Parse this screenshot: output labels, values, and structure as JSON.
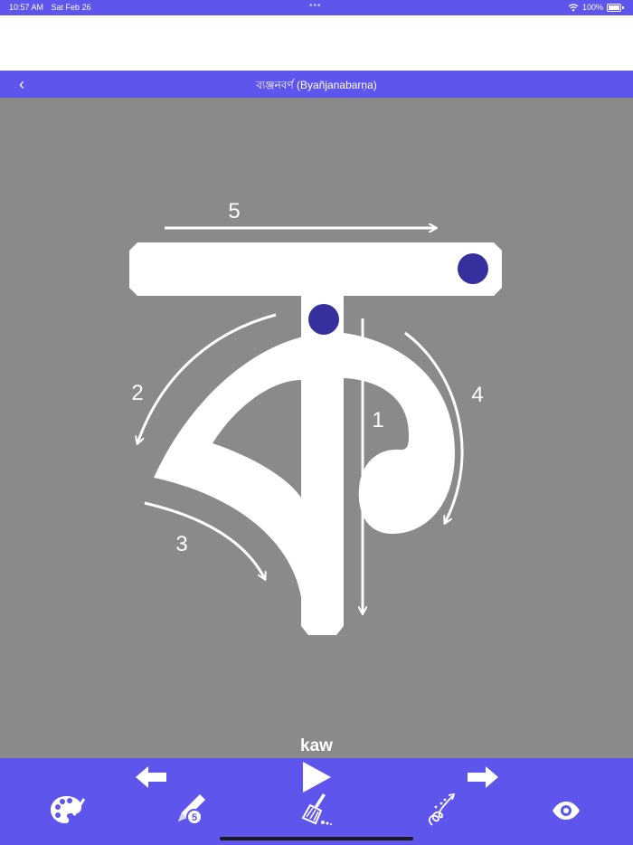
{
  "status_bar": {
    "time": "10:57 AM",
    "date": "Sat Feb 26",
    "dots": "•••",
    "battery": "100%"
  },
  "nav": {
    "back_label": "‹",
    "title": "ব্যঞ্জনবর্ণ (Byañjanabarṇa)"
  },
  "letter": {
    "stroke_numbers": [
      "1",
      "2",
      "3",
      "4",
      "5"
    ],
    "name": "kaw"
  },
  "toolbar": {
    "pencil_badge": "5",
    "icons": [
      "arrow-left-icon",
      "play-icon",
      "arrow-right-icon",
      "palette-icon",
      "pencil-icon",
      "broom-icon",
      "trace-path-icon",
      "eye-icon"
    ]
  },
  "colors": {
    "accent": "#5d55ec",
    "canvas": "#8a8a8a",
    "dot": "#36309e"
  }
}
